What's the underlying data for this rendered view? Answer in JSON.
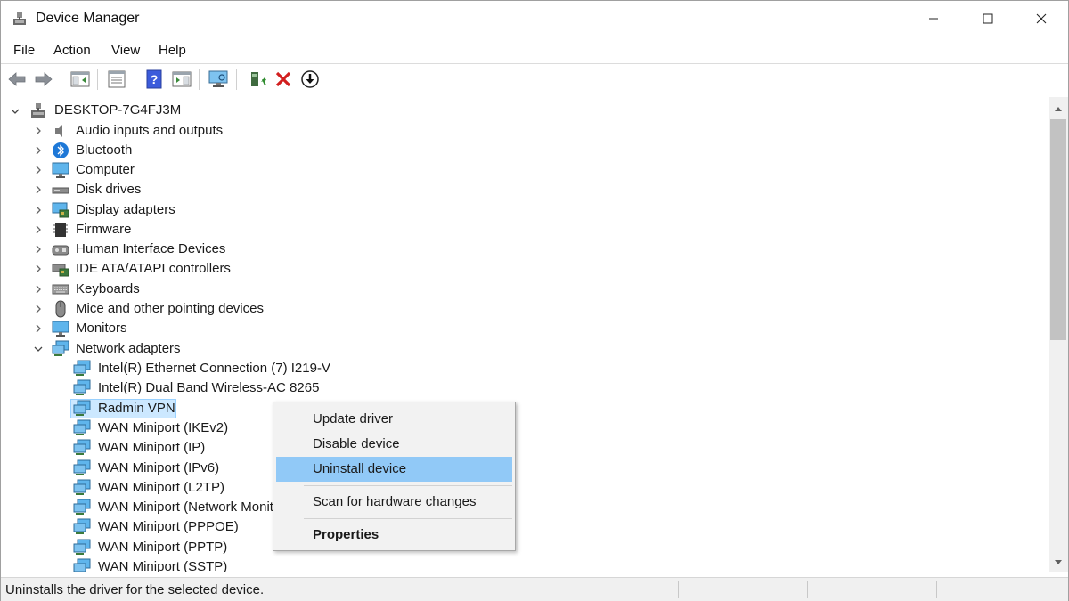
{
  "window": {
    "title": "Device Manager"
  },
  "titlebar": {
    "minimize_icon": "minimize-icon",
    "maximize_icon": "maximize-icon",
    "close_icon": "close-icon"
  },
  "menu": [
    "File",
    "Action",
    "View",
    "Help"
  ],
  "toolbar": {
    "buttons": [
      "back-arrow-icon",
      "forward-arrow-icon",
      "show-hide-console-tree-icon",
      "properties-icon",
      "help-icon",
      "show-action-pane-icon",
      "scan-hardware-icon",
      "update-driver-icon",
      "uninstall-device-icon",
      "disable-device-icon"
    ]
  },
  "tree": {
    "root": "DESKTOP-7G4FJ3M",
    "categories": [
      "Audio inputs and outputs",
      "Bluetooth",
      "Computer",
      "Disk drives",
      "Display adapters",
      "Firmware",
      "Human Interface Devices",
      "IDE ATA/ATAPI controllers",
      "Keyboards",
      "Mice and other pointing devices",
      "Monitors",
      "Network adapters"
    ],
    "network_adapters": [
      "Intel(R) Ethernet Connection (7) I219-V",
      "Intel(R) Dual Band Wireless-AC 8265",
      "Radmin VPN",
      "WAN Miniport (IKEv2)",
      "WAN Miniport (IP)",
      "WAN Miniport (IPv6)",
      "WAN Miniport (L2TP)",
      "WAN Miniport (Network Monitor)",
      "WAN Miniport (PPPOE)",
      "WAN Miniport (PPTP)",
      "WAN Miniport (SSTP)"
    ],
    "selected": "Radmin VPN"
  },
  "context_menu": {
    "items": [
      "Update driver",
      "Disable device",
      "Uninstall device",
      "Scan for hardware changes",
      "Properties"
    ],
    "highlighted": "Uninstall device",
    "default": "Properties"
  },
  "status": {
    "text": "Uninstalls the driver for the selected device."
  },
  "colors": {
    "selection": "#cce8ff",
    "menu_highlight": "#91c9f7",
    "accent": "#1e78d7"
  }
}
